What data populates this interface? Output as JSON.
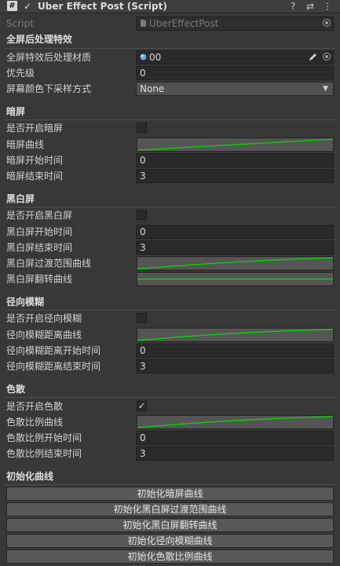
{
  "header": {
    "title": "Uber Effect Post (Script)",
    "icon_glyph": "#",
    "enabled_check": "✓",
    "help_glyph": "?",
    "settings_glyph": "⇄",
    "more_glyph": "⋮"
  },
  "script_row": {
    "label": "Script",
    "value": "UberEffectPost"
  },
  "fullscreen": {
    "section_title": "全屏后处理特效",
    "material_label": "全屏特效后处理材质",
    "material_value": "00",
    "priority_label": "优先级",
    "priority_value": "0",
    "downsample_label": "屏幕颜色下采样方式",
    "downsample_value": "None"
  },
  "dark": {
    "section_title": "暗屏",
    "enable_label": "是否开启暗屏",
    "enable_checked": false,
    "curve_label": "暗屏曲线",
    "start_label": "暗屏开始时间",
    "start_value": "0",
    "end_label": "暗屏结束时间",
    "end_value": "3"
  },
  "bw": {
    "section_title": "黑白屏",
    "enable_label": "是否开启黑白屏",
    "enable_checked": false,
    "start_label": "黑白屏开始时间",
    "start_value": "0",
    "end_label": "黑白屏结束时间",
    "end_value": "3",
    "transition_curve_label": "黑白屏过渡范围曲线",
    "flip_curve_label": "黑白屏翻转曲线"
  },
  "radial": {
    "section_title": "径向模糊",
    "enable_label": "是否开启径向模糊",
    "enable_checked": false,
    "curve_label": "径向模糊距离曲线",
    "start_label": "径向模糊距离开始时间",
    "start_value": "0",
    "end_label": "径向模糊距离结束时间",
    "end_value": "3"
  },
  "chroma": {
    "section_title": "色散",
    "enable_label": "是否开启色散",
    "enable_checked": true,
    "check_glyph": "✓",
    "curve_label": "色散比例曲线",
    "start_label": "色散比例开始时间",
    "start_value": "0",
    "end_label": "色散比例结束时间",
    "end_value": "3"
  },
  "init": {
    "section_title": "初始化曲线",
    "buttons": [
      "初始化暗屏曲线",
      "初始化黑白屏过渡范围曲线",
      "初始化黑白屏翻转曲线",
      "初始化径向模糊曲线",
      "初始化色散比例曲线"
    ]
  },
  "colors": {
    "background": "#383838",
    "curve_line": "#00e000",
    "curve_bg": "#555555",
    "field_bg": "#2a2a2a"
  }
}
